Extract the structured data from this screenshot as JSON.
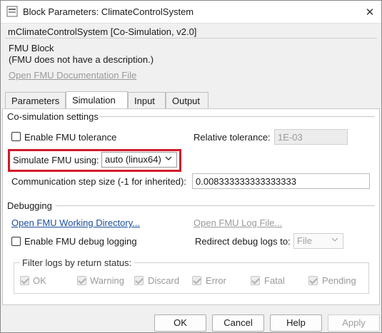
{
  "window": {
    "title": "Block Parameters: ClimateControlSystem",
    "close_glyph": "✕"
  },
  "header": {
    "fmu_title": "mClimateControlSystem [Co-Simulation, v2.0]",
    "block_type": "FMU Block",
    "block_description": "(FMU does not have a description.)",
    "doc_link": "Open FMU Documentation File"
  },
  "tabs": [
    {
      "label": "Parameters",
      "active": false
    },
    {
      "label": "Simulation",
      "active": true
    },
    {
      "label": "Input",
      "active": false
    },
    {
      "label": "Output",
      "active": false
    }
  ],
  "cosim": {
    "group_label": "Co-simulation settings",
    "enable_tolerance_label": "Enable FMU tolerance",
    "enable_tolerance_checked": false,
    "relative_tolerance_label": "Relative tolerance:",
    "relative_tolerance_value": "1E-03",
    "simulate_using_label": "Simulate FMU using:",
    "simulate_using_value": "auto (linux64)",
    "step_size_label": "Communication step size (-1 for inherited):",
    "step_size_value": "0.008333333333333333"
  },
  "debugging": {
    "group_label": "Debugging",
    "open_working_dir_link": "Open FMU Working Directory...",
    "open_log_link": "Open FMU Log File...",
    "enable_debug_label": "Enable FMU debug logging",
    "enable_debug_checked": false,
    "redirect_label": "Redirect debug logs to:",
    "redirect_value": "File",
    "filter_title": "Filter logs by return status:",
    "filters": [
      {
        "label": "OK",
        "checked": true
      },
      {
        "label": "Warning",
        "checked": true
      },
      {
        "label": "Discard",
        "checked": true
      },
      {
        "label": "Error",
        "checked": true
      },
      {
        "label": "Fatal",
        "checked": true
      },
      {
        "label": "Pending",
        "checked": true
      }
    ]
  },
  "buttons": {
    "ok": "OK",
    "cancel": "Cancel",
    "help": "Help",
    "apply": "Apply"
  },
  "colors": {
    "highlight": "#d11a2a",
    "link": "#1a4f9c"
  }
}
